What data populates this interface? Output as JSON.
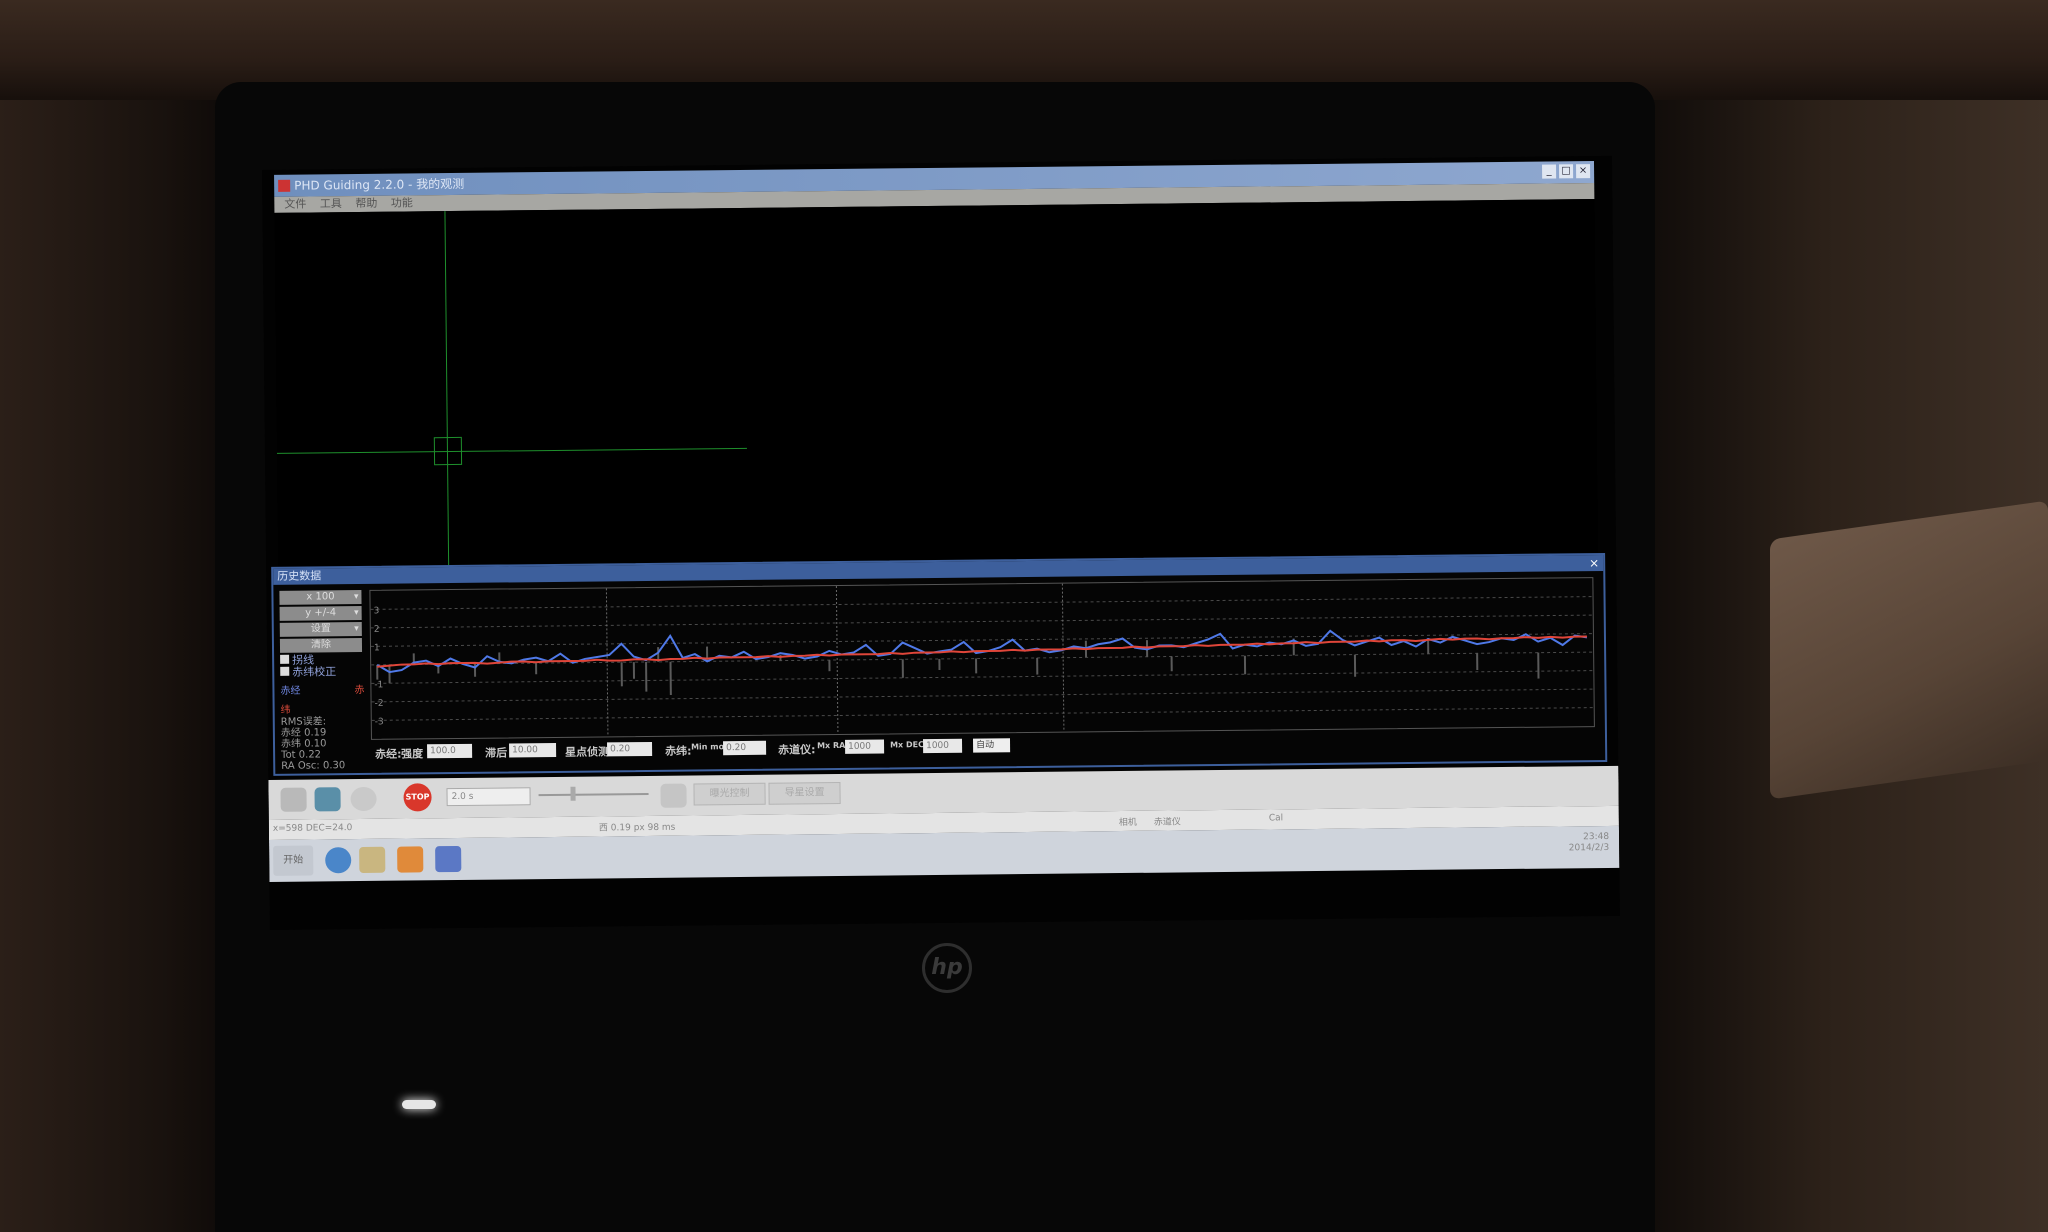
{
  "window": {
    "title": "PHD Guiding 2.2.0 - 我的观测"
  },
  "menu": {
    "items": [
      "文件",
      "工具",
      "帮助",
      "功能"
    ]
  },
  "history": {
    "title": "历史数据",
    "close": "×",
    "scale_options": {
      "x_scale": "x 100",
      "y_scale": "y +/-4",
      "settings": "设置",
      "clear": "清除"
    },
    "checkboxes": [
      {
        "label": "拐线",
        "checked": true
      },
      {
        "label": "赤纬校正",
        "checked": true
      }
    ],
    "legend": {
      "ra": "赤经",
      "dec": "赤纬"
    },
    "rms_title": "RMS误差:",
    "rms": {
      "ra": "赤经 0.19",
      "dec": "赤纬 0.10",
      "tot": "Tot 0.22",
      "ra_osc": "RA Osc: 0.30"
    }
  },
  "chart_data": {
    "type": "line",
    "ylim": [
      -4,
      4
    ],
    "y_ticks": [
      "3",
      "2",
      "1",
      "-1",
      "-2",
      "-3"
    ],
    "series": [
      {
        "name": "赤经",
        "color": "#4f79e8",
        "values": [
          0.0,
          -0.4,
          -0.3,
          0.1,
          0.2,
          -0.1,
          0.3,
          0.0,
          -0.2,
          0.4,
          0.1,
          0.0,
          0.2,
          0.3,
          0.1,
          0.5,
          0.0,
          0.2,
          0.3,
          0.4,
          1.0,
          0.3,
          0.1,
          0.5,
          1.4,
          0.2,
          0.4,
          0.0,
          0.3,
          0.2,
          0.5,
          0.1,
          0.2,
          0.4,
          0.3,
          0.1,
          0.2,
          0.5,
          0.3,
          0.4,
          0.8,
          0.2,
          0.3,
          0.9,
          0.6,
          0.3,
          0.4,
          0.5,
          0.9,
          0.3,
          0.4,
          0.6,
          1.0,
          0.4,
          0.5,
          0.3,
          0.4,
          0.6,
          0.5,
          0.7,
          0.8,
          1.0,
          0.5,
          0.4,
          0.6,
          0.6,
          0.5,
          0.7,
          0.9,
          1.2,
          0.4,
          0.6,
          0.5,
          0.7,
          0.6,
          0.8,
          0.5,
          0.6,
          1.3,
          0.8,
          0.5,
          0.7,
          0.9,
          0.5,
          0.7,
          0.4,
          0.8,
          0.6,
          0.9,
          0.7,
          0.5,
          0.6,
          0.8,
          0.7,
          1.0,
          0.6,
          0.8,
          0.4,
          0.9,
          0.8
        ],
        "bars": [
          -0.8,
          -1.0,
          0,
          0.6,
          0,
          -0.5,
          0,
          0,
          -0.7,
          0,
          0.6,
          0,
          0,
          -0.6,
          0,
          0,
          0,
          0,
          0,
          0,
          -1.3,
          -0.9,
          -1.6,
          0.8,
          -1.8,
          0,
          0,
          0.8,
          0,
          0,
          0,
          0,
          0,
          0.3,
          0,
          0,
          0,
          -0.6,
          0,
          0,
          0,
          0,
          0,
          -1.0,
          0,
          0,
          -0.6,
          0,
          0,
          -0.8,
          0,
          0,
          0,
          0,
          -0.9,
          0,
          0,
          0,
          0.9,
          0,
          0,
          0,
          0,
          0.9,
          0,
          -0.8,
          0,
          0,
          0,
          0,
          0,
          -1.0,
          0,
          0,
          0,
          0.9,
          0,
          0,
          0,
          0,
          -1.2,
          0,
          0,
          0,
          0,
          0,
          0.7,
          0,
          0,
          0,
          -0.9,
          0,
          0,
          0,
          0,
          -1.4,
          0,
          0,
          0,
          0
        ]
      },
      {
        "name": "赤纬",
        "color": "#e0463a",
        "values": [
          -0.1,
          -0.05,
          0.0,
          0.0,
          0.05,
          0.0,
          0.05,
          0.05,
          0.05,
          0.0,
          0.05,
          0.1,
          0.1,
          0.05,
          0.1,
          0.1,
          0.1,
          0.1,
          0.15,
          0.1,
          0.1,
          0.15,
          0.15,
          0.1,
          0.15,
          0.15,
          0.2,
          0.15,
          0.2,
          0.2,
          0.2,
          0.2,
          0.25,
          0.2,
          0.25,
          0.25,
          0.3,
          0.25,
          0.3,
          0.3,
          0.3,
          0.3,
          0.35,
          0.3,
          0.35,
          0.35,
          0.35,
          0.4,
          0.35,
          0.4,
          0.4,
          0.4,
          0.45,
          0.4,
          0.45,
          0.45,
          0.45,
          0.5,
          0.45,
          0.5,
          0.5,
          0.5,
          0.55,
          0.5,
          0.55,
          0.55,
          0.55,
          0.6,
          0.55,
          0.6,
          0.6,
          0.6,
          0.65,
          0.6,
          0.65,
          0.65,
          0.7,
          0.65,
          0.7,
          0.7,
          0.7,
          0.75,
          0.7,
          0.75,
          0.75,
          0.7,
          0.75,
          0.8,
          0.75,
          0.8,
          0.8,
          0.75,
          0.8,
          0.8,
          0.85,
          0.8,
          0.85,
          0.8,
          0.85,
          0.85
        ]
      }
    ]
  },
  "controls": {
    "ra_label": "赤经:",
    "aggr_label": "强度",
    "aggr_value": "100.0",
    "hyst_label": "滞后",
    "hyst_value": "10.00",
    "star_label": "星点侦测",
    "star_value": "0.20",
    "dec_label": "赤纬:",
    "min_mo_label": "Min mo",
    "min_mo_value": "0.20",
    "mount_label": "赤道仪:",
    "max_ra_label": "Mx RA",
    "max_ra_value": "1000",
    "max_dec_label": "Mx DEC",
    "max_dec_value": "1000",
    "mode_value": "自动"
  },
  "toolbar": {
    "stop": "STOP",
    "exposure": "2.0 s",
    "btn1": "曝光控制",
    "btn2": "导星设置"
  },
  "status": {
    "left": "x=598 DEC=24.0",
    "center": "西  0.19 px  98 ms",
    "right1": "相机",
    "right2": "赤道仪",
    "right3": "Cal"
  },
  "taskbar": {
    "start": "开始",
    "tray_time": "23:48",
    "tray_date": "2014/2/3"
  }
}
